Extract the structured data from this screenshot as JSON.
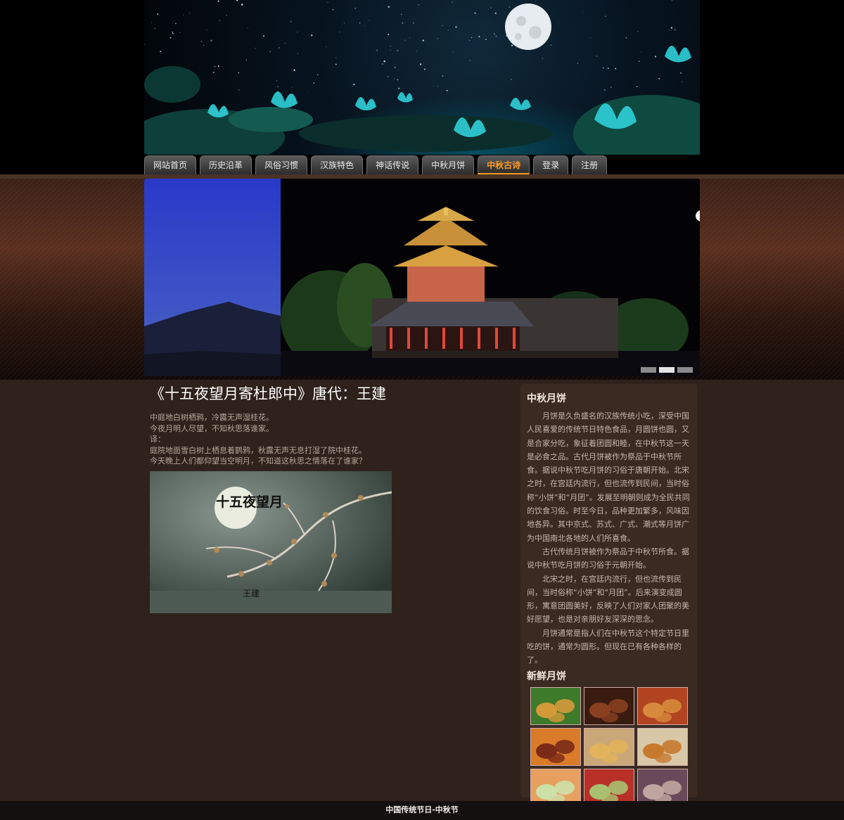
{
  "nav": {
    "items": [
      {
        "label": "网站首页",
        "active": false
      },
      {
        "label": "历史沿革",
        "active": false
      },
      {
        "label": "风俗习惯",
        "active": false
      },
      {
        "label": "汉族特色",
        "active": false
      },
      {
        "label": "神话传说",
        "active": false
      },
      {
        "label": "中秋月饼",
        "active": false
      },
      {
        "label": "中秋古诗",
        "active": true
      },
      {
        "label": "登录",
        "active": false
      },
      {
        "label": "注册",
        "active": false
      }
    ]
  },
  "slider": {
    "dots": 3,
    "active_dot": 2
  },
  "poem": {
    "title": "《十五夜望月寄杜郎中》唐代：王建",
    "lines": [
      "中庭地白树栖鸦，冷露无声湿桂花。",
      "今夜月明人尽望，不知秋思落谁家。",
      "译：",
      "庭院地面雪白树上栖息着鹊鸦，秋露无声无息打湿了院中桂花。",
      "今天晚上人们都仰望当空明月，不知道这秋思之情落在了谁家？"
    ],
    "image_caption": "十五夜望月",
    "image_author": "王建"
  },
  "sidebar": {
    "mooncake_heading": "中秋月饼",
    "paragraphs": [
      "月饼是久负盛名的汉族传统小吃，深受中国人民喜爱的传统节日特色食品，月圆饼也圆，又是合家分吃，象征着团圆和睦，在中秋节这一天是必食之品。古代月饼被作为祭品于中秋节所食。据说中秋节吃月饼的习俗于唐朝开始。北宋之时，在宫廷内流行，但也流传到民间，当时俗称“小饼”和“月团”。发展至明朝则成为全民共同的饮食习俗。时至今日，品种更加繁多，风味因地各异。其中京式、苏式、广式、潮式等月饼广为中国南北各地的人们所喜食。",
      "古代传统月饼被作为祭品于中秋节所食。据说中秋节吃月饼的习俗于元朝开始。",
      "北宋之时，在宫廷内流行，但也流传到民间，当时俗称“小饼”和“月团”。后来演变成圆形，寓意团圆美好，反映了人们对家人团聚的美好愿望，也是对亲朋好友深深的思念。",
      "月饼通常是指人们在中秋节这个特定节日里吃的饼，通常为圆形。但现在已有各种各样的了。"
    ],
    "fresh_heading": "新鲜月饼",
    "cakes": [
      {
        "bg": "#3d7a2a",
        "cake": "#d49a3a"
      },
      {
        "bg": "#3a1b10",
        "cake": "#8a4020"
      },
      {
        "bg": "#b24422",
        "cake": "#d88a3c"
      },
      {
        "bg": "#d97b28",
        "cake": "#7a2a16"
      },
      {
        "bg": "#caa778",
        "cake": "#e1b35a"
      },
      {
        "bg": "#d8c8a8",
        "cake": "#c77a2e"
      },
      {
        "bg": "#e8a060",
        "cake": "#cde0a8"
      },
      {
        "bg": "#b83028",
        "cake": "#a8c070"
      },
      {
        "bg": "#6a4a5a",
        "cake": "#bfa6a0"
      }
    ]
  },
  "footer": {
    "text": "中国传统节日-中秋节"
  },
  "colors": {
    "accent": "#ff9a1e",
    "background": "#2f211b",
    "sidebar": "#3b2a22"
  }
}
